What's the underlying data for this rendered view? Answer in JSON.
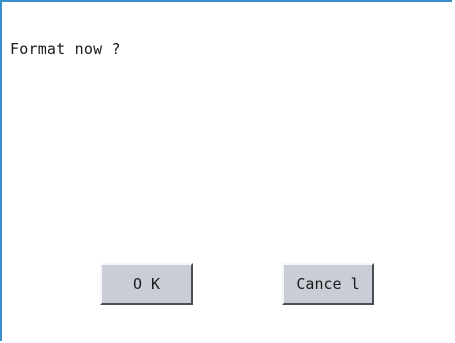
{
  "dialog": {
    "message": "Format now ?",
    "ok_label": "O K",
    "cancel_label": "Cance l"
  },
  "colors": {
    "frame_border": "#3a8fc8",
    "button_face": "#c9ced6",
    "background": "#ffffff"
  }
}
